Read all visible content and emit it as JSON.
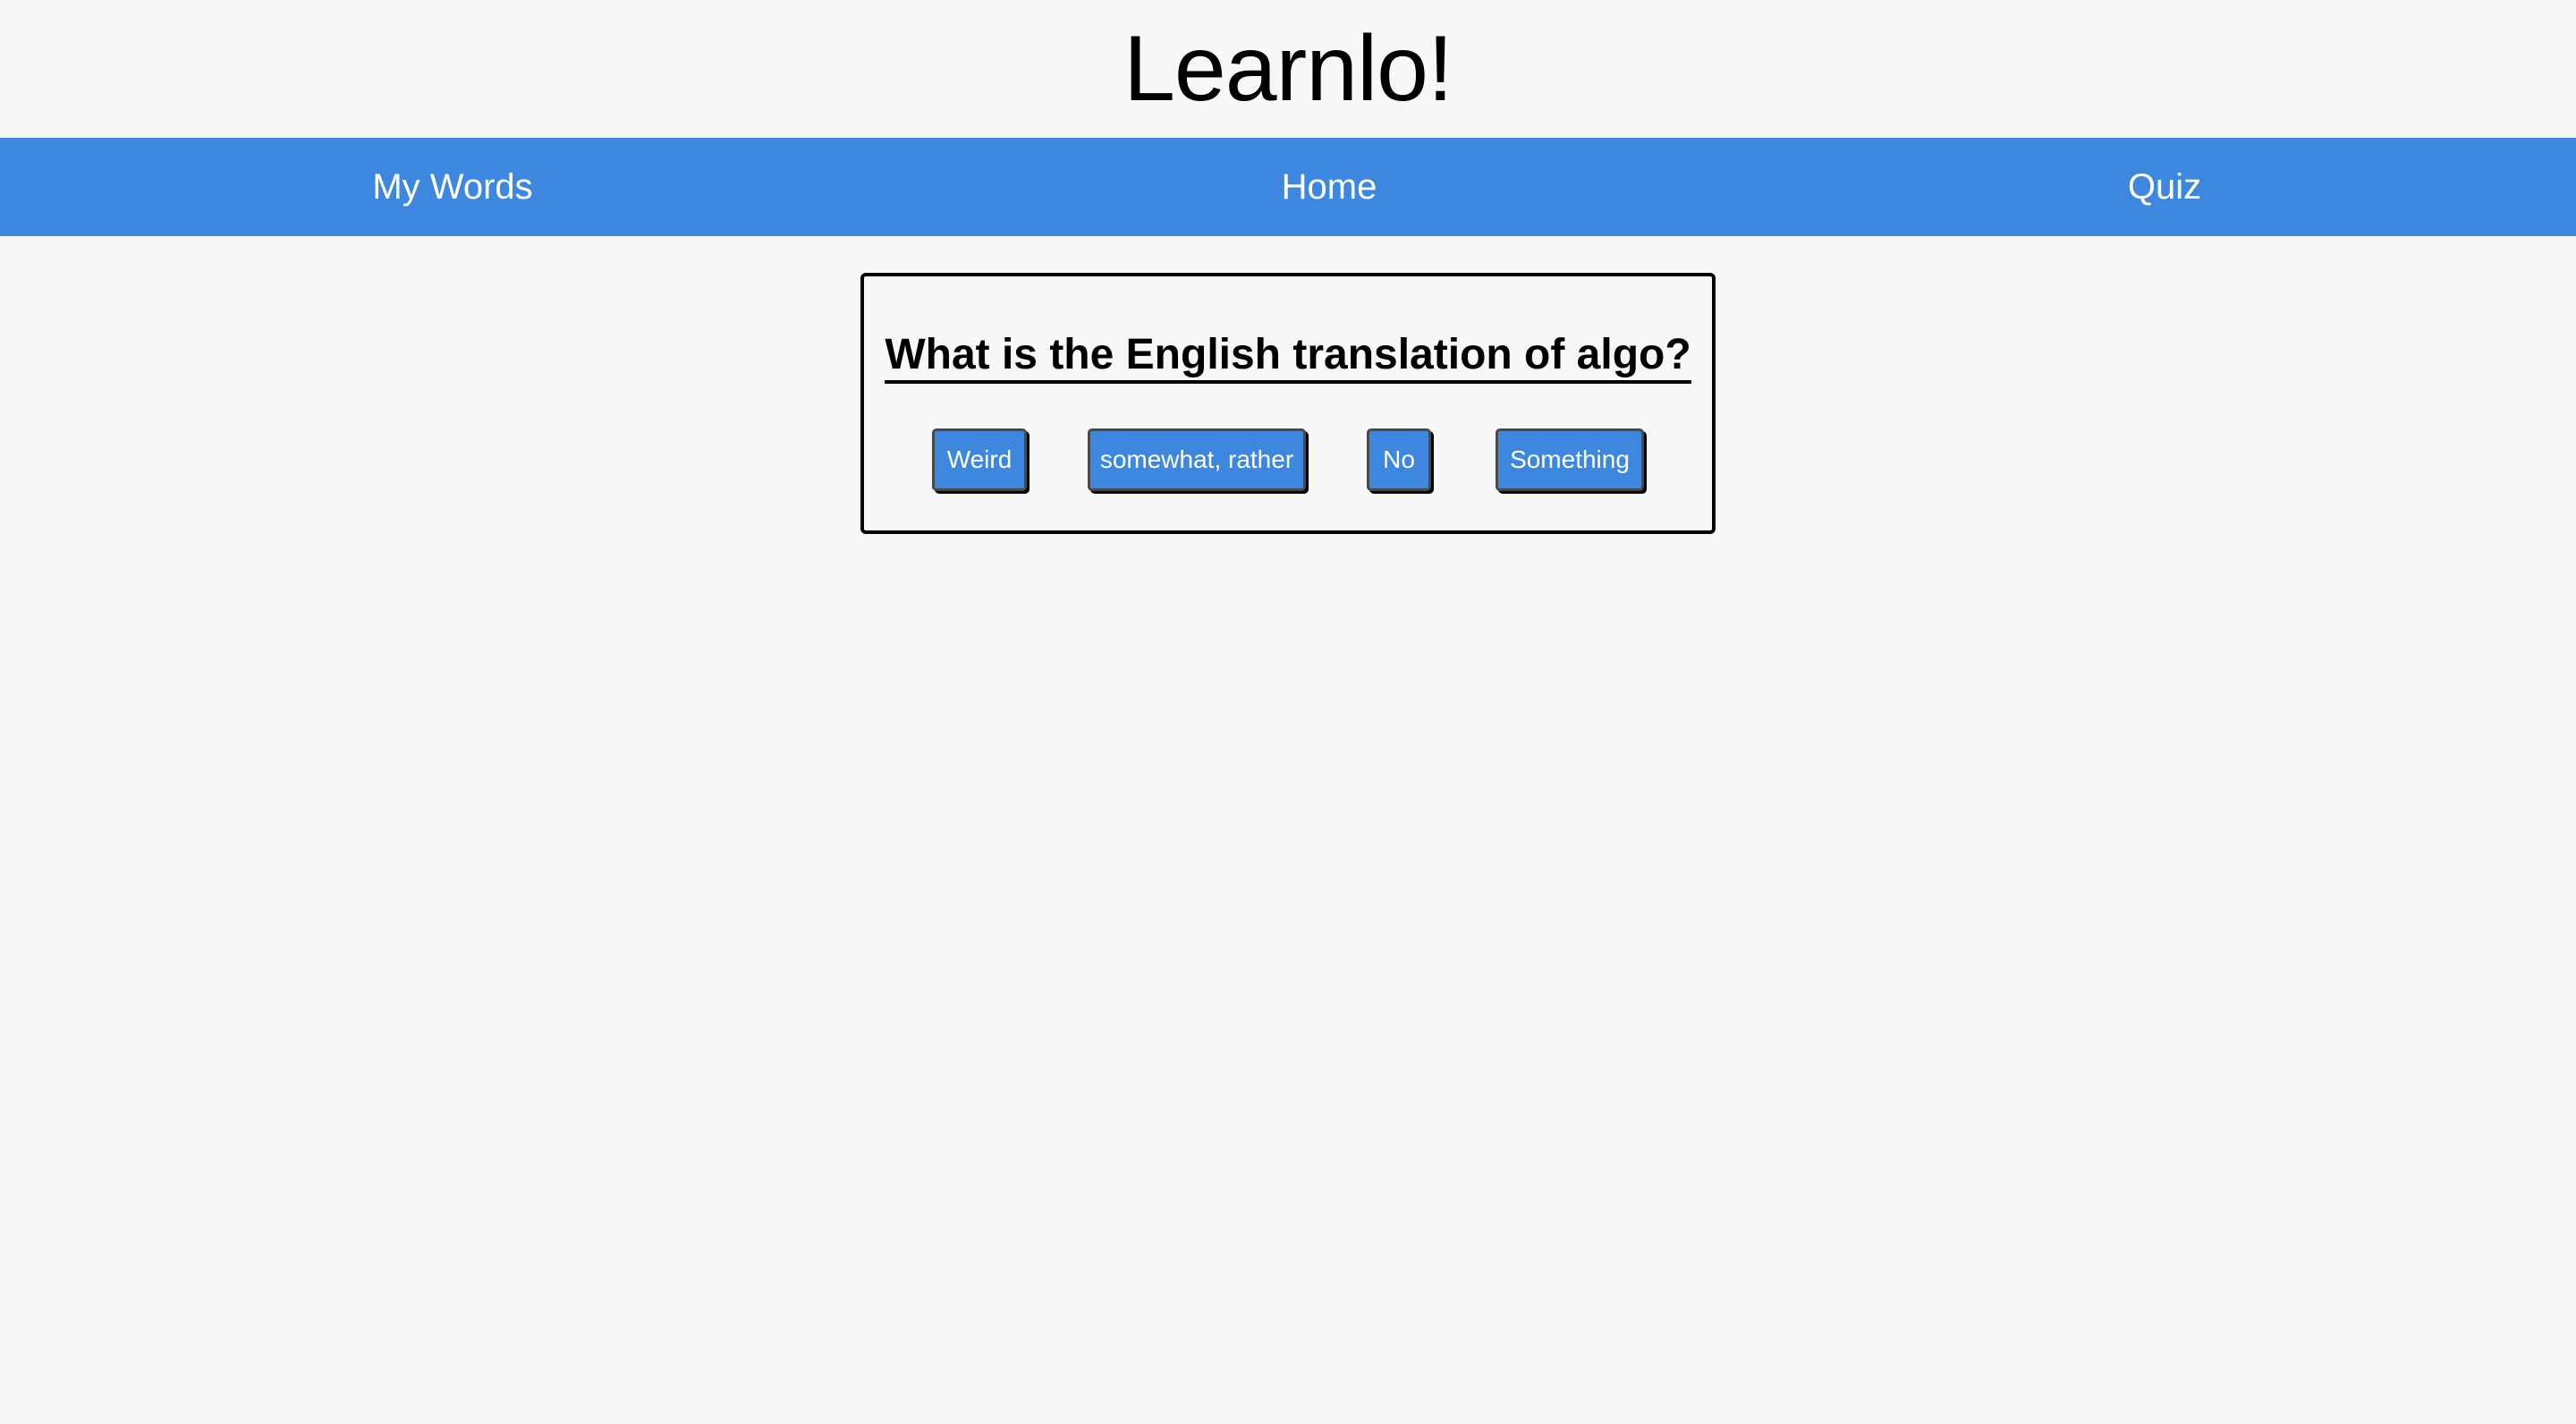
{
  "header": {
    "title": "Learnlo!"
  },
  "nav": {
    "items": [
      {
        "label": "My Words"
      },
      {
        "label": "Home"
      },
      {
        "label": "Quiz"
      }
    ]
  },
  "quiz": {
    "question": "What is the English translation of algo?",
    "answers": [
      {
        "label": "Weird"
      },
      {
        "label": "somewhat, rather"
      },
      {
        "label": "No"
      },
      {
        "label": "Something"
      }
    ]
  },
  "colors": {
    "accent": "#3d87de",
    "background": "#f7f7f7",
    "text": "#000000"
  }
}
